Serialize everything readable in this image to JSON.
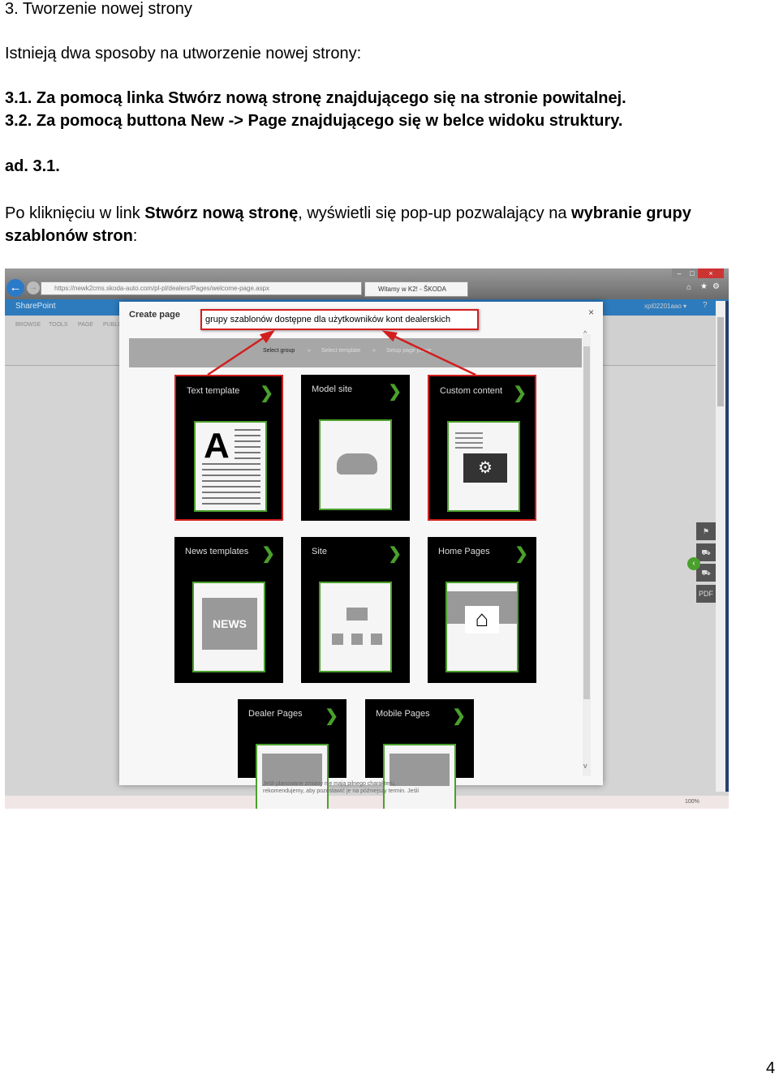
{
  "doc": {
    "heading": "3. Tworzenie nowej strony",
    "intro": "Istnieją dwa sposoby na utworzenie nowej strony:",
    "item1": "3.1. Za pomocą linka Stwórz nową stronę znajdującego się na stronie powitalnej.",
    "item2": "3.2. Za pomocą buttona New -> Page znajdującego się w belce widoku struktury.",
    "ad": "ad. 3.1.",
    "p_a": "Po kliknięciu w link ",
    "p_b": "Stwórz nową stronę",
    "p_c": ", wyświetli się pop-up pozwalający na ",
    "p_d": "wybranie grupy",
    "p_e": "szablonów stron",
    "p_f": ":",
    "page_number": "4"
  },
  "browser": {
    "url": "https://newk2cms.skoda-auto.com/pl-pl/dealers/Pages/welcome-page.aspx",
    "tab": "Witamy w K2! - ŠKODA",
    "app": "SharePoint",
    "ribbon": [
      "BROWSE",
      "TOOLS",
      "PAGE",
      "PUBLI"
    ],
    "user": "xpl02201aao ▾",
    "help": "?",
    "zoom": "100%",
    "footer_line1": "Jeśli planowane zmiany nie mają pilnego charakteru,",
    "footer_line2": "rekomendujemy, aby pozostawić je na późniejszy termin. Jeśli"
  },
  "popup": {
    "title": "Create page",
    "close": "×",
    "annotation": "grupy szablonów dostępne dla użytkowników kont dealerskich",
    "steps": [
      "Select group",
      "»",
      "Select template",
      "»",
      "Setup page prope"
    ],
    "tiles": [
      {
        "label": "Text template",
        "selected": true,
        "icon": "text-template-icon"
      },
      {
        "label": "Model site",
        "selected": false,
        "icon": "car-icon"
      },
      {
        "label": "Custom content",
        "selected": true,
        "icon": "gear-icon"
      },
      {
        "label": "News templates",
        "selected": false,
        "icon": "news-icon",
        "icon_text": "NEWS"
      },
      {
        "label": "Site",
        "selected": false,
        "icon": "sitemap-icon"
      },
      {
        "label": "Home Pages",
        "selected": false,
        "icon": "home-icon"
      },
      {
        "label": "Dealer Pages",
        "selected": false,
        "icon": "dealer-icon"
      },
      {
        "label": "Mobile Pages",
        "selected": false,
        "icon": "mobile-icon"
      }
    ]
  },
  "colors": {
    "accent": "#4aa02c",
    "annotation": "#d31e1e",
    "sharepoint": "#2d7bbd"
  }
}
